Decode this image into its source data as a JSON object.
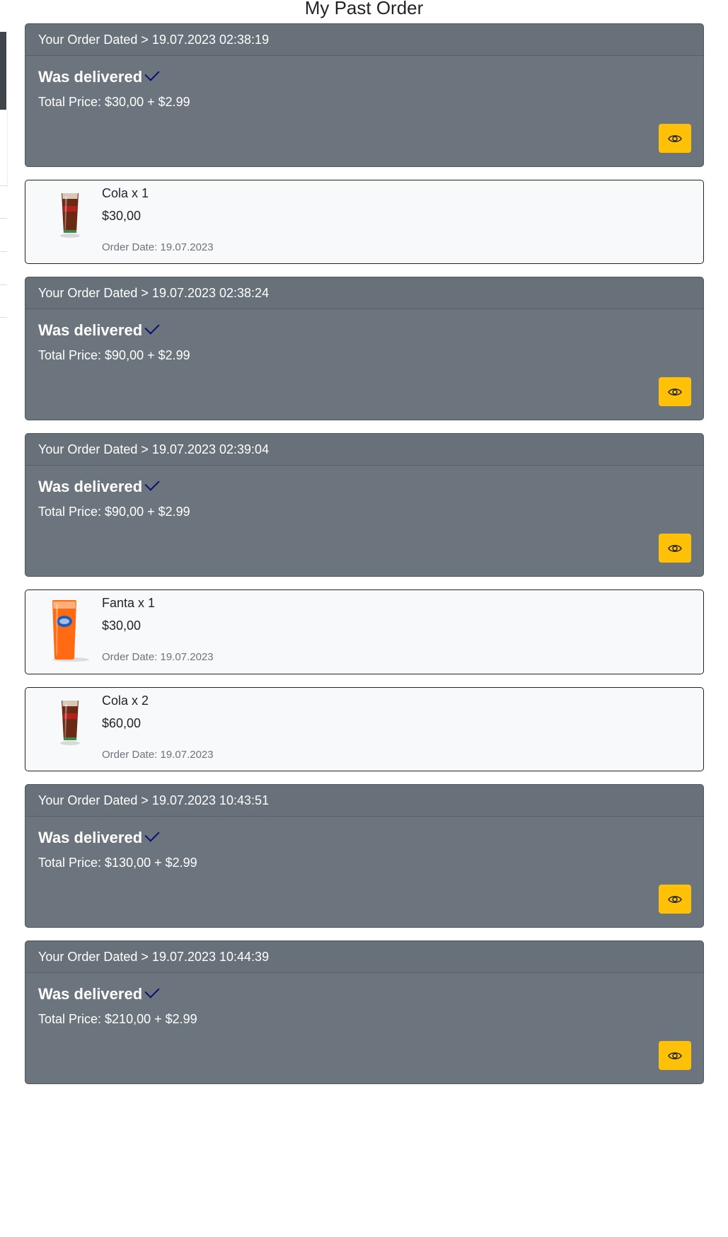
{
  "page": {
    "title": "My Past Order"
  },
  "icons": {
    "check": "check-icon",
    "view": "eye-icon"
  },
  "colors": {
    "order_card": "#6c757d",
    "view_button": "#ffc107",
    "check": "#0a0f70"
  },
  "entries": [
    {
      "type": "order",
      "header": "Your Order Dated > 19.07.2023 02:38:19",
      "status": "Was delivered",
      "total": "Total Price: $30,00 + $2.99"
    },
    {
      "type": "item",
      "thumb": "cola",
      "name": "Cola x 1",
      "price": "$30,00",
      "date": "Order Date: 19.07.2023"
    },
    {
      "type": "order",
      "header": "Your Order Dated > 19.07.2023 02:38:24",
      "status": "Was delivered",
      "total": "Total Price: $90,00 + $2.99"
    },
    {
      "type": "order",
      "header": "Your Order Dated > 19.07.2023 02:39:04",
      "status": "Was delivered",
      "total": "Total Price: $90,00 + $2.99"
    },
    {
      "type": "item",
      "thumb": "fanta",
      "name": "Fanta x 1",
      "price": "$30,00",
      "date": "Order Date: 19.07.2023"
    },
    {
      "type": "item",
      "thumb": "cola",
      "name": "Cola x 2",
      "price": "$60,00",
      "date": "Order Date: 19.07.2023"
    },
    {
      "type": "order",
      "header": "Your Order Dated > 19.07.2023 10:43:51",
      "status": "Was delivered",
      "total": "Total Price: $130,00 + $2.99"
    },
    {
      "type": "order",
      "header": "Your Order Dated > 19.07.2023 10:44:39",
      "status": "Was delivered",
      "total": "Total Price: $210,00 + $2.99"
    }
  ]
}
